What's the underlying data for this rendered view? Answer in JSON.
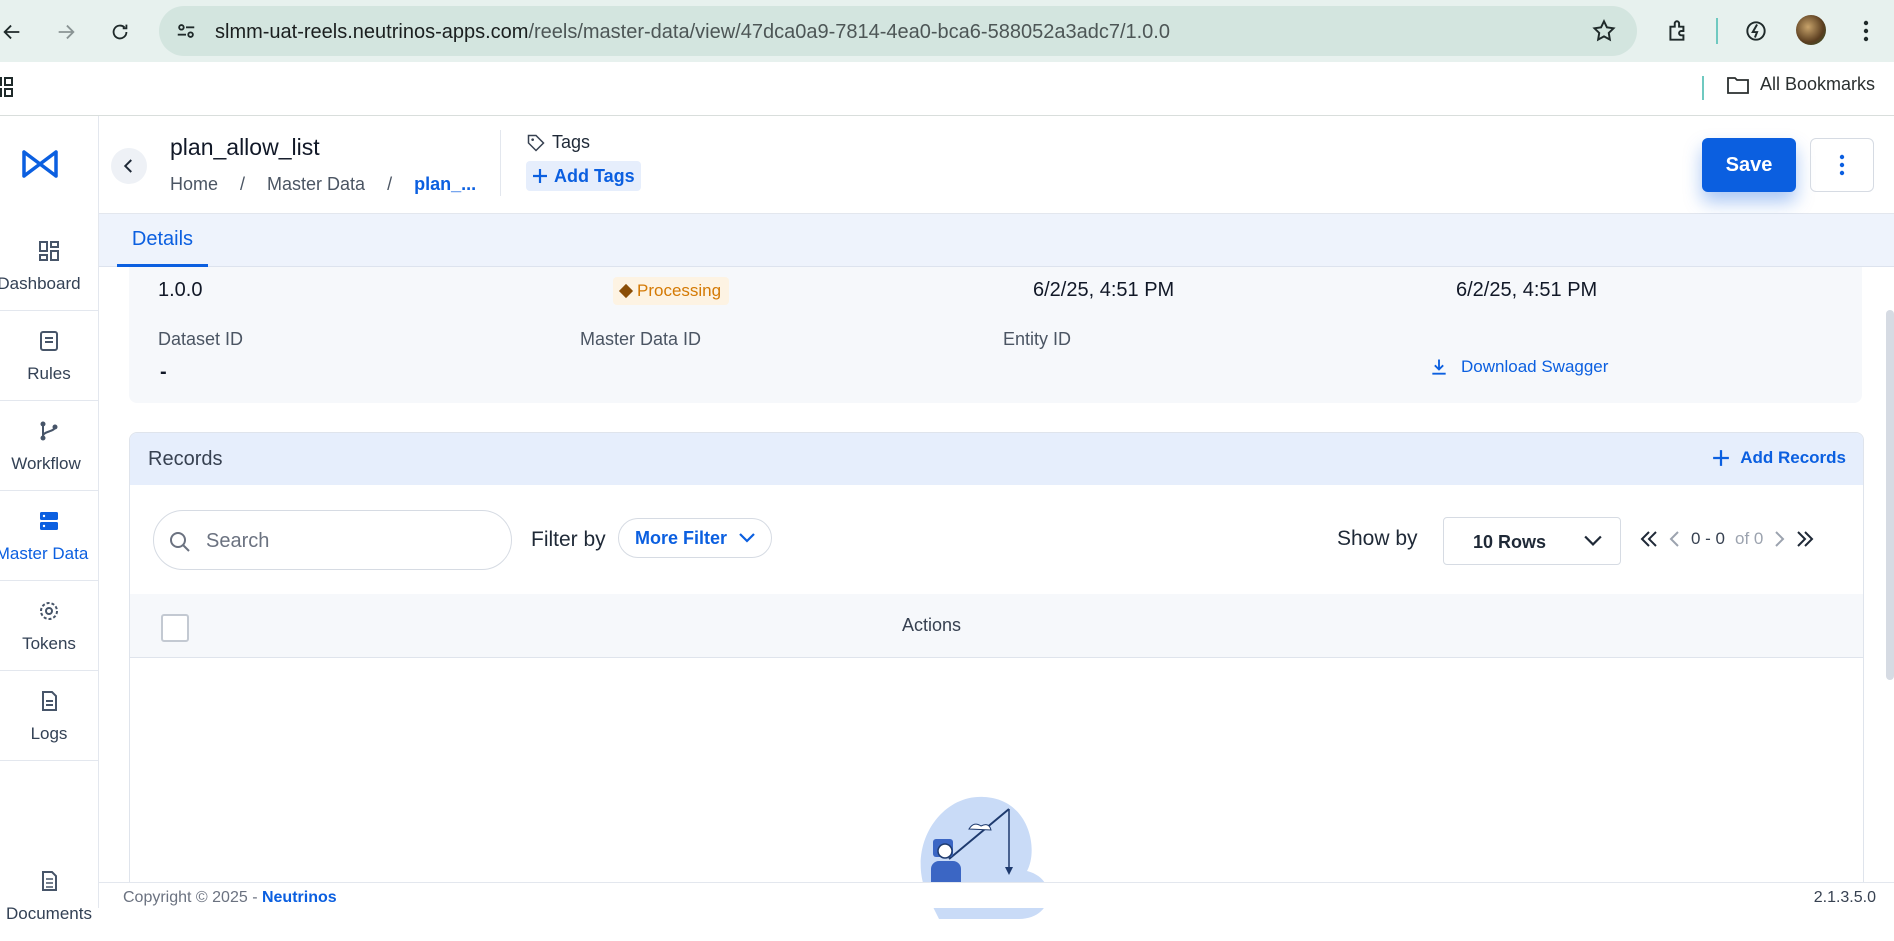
{
  "browser": {
    "url_host": "slmm-uat-reels.neutrinos-apps.com",
    "url_path": "/reels/master-data/view/47dca0a9-7814-4ea0-bca6-588052a3adc7/1.0.0",
    "all_bookmarks": "All Bookmarks"
  },
  "sidebar": {
    "items": [
      {
        "label": "Dashboard",
        "icon": "dashboard-icon"
      },
      {
        "label": "Rules",
        "icon": "rules-icon"
      },
      {
        "label": "Workflow",
        "icon": "workflow-icon"
      },
      {
        "label": "Master Data",
        "icon": "master-data-icon",
        "active": true
      },
      {
        "label": "Tokens",
        "icon": "tokens-icon"
      },
      {
        "label": "Logs",
        "icon": "logs-icon"
      },
      {
        "label": "Documents",
        "icon": "documents-icon"
      }
    ]
  },
  "header": {
    "title": "plan_allow_list",
    "breadcrumb": [
      "Home",
      "Master Data",
      "plan_..."
    ],
    "tags_label": "Tags",
    "add_tags_label": "Add Tags",
    "save_label": "Save"
  },
  "tabs": [
    {
      "label": "Details",
      "active": true
    }
  ],
  "details": {
    "version": "1.0.0",
    "status": "Processing",
    "created": "6/2/25, 4:51 PM",
    "updated": "6/2/25, 4:51 PM",
    "dataset_id_label": "Dataset ID",
    "dataset_id_value": "-",
    "master_data_id_label": "Master Data ID",
    "entity_id_label": "Entity ID",
    "download_swagger": "Download Swagger"
  },
  "records": {
    "title": "Records",
    "add_records": "Add Records",
    "search_placeholder": "Search",
    "filter_by_label": "Filter by",
    "more_filter_label": "More Filter",
    "show_by_label": "Show by",
    "rows_value": "10 Rows",
    "pager_range": "0 - 0",
    "pager_of": "of 0",
    "columns": [
      "Actions"
    ]
  },
  "footer": {
    "copyright": "Copyright © 2025",
    "brand": "Neutrinos",
    "version": "2.1.3.5.0"
  },
  "colors": {
    "accent": "#0b5fe0",
    "status": "#d47a05",
    "chrome": "#e7f1ee"
  }
}
